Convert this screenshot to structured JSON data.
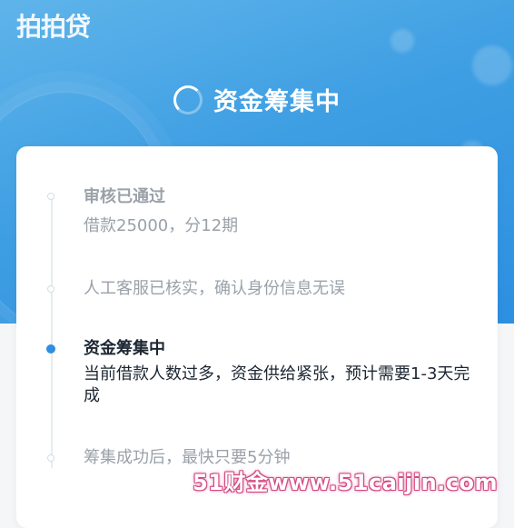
{
  "app": {
    "logo_text": "拍拍贷"
  },
  "status": {
    "title": "资金筹集中"
  },
  "steps": [
    {
      "title": "审核已通过",
      "desc": "借款25000，分12期"
    },
    {
      "title": "人工客服已核实，确认身份信息无误"
    },
    {
      "title": "资金筹集中",
      "desc": "当前借款人数过多，资金供给紧张，预计需要1-3天完成"
    },
    {
      "title": "筹集成功后，最快只要5分钟"
    }
  ],
  "watermark": {
    "text": "51财金www.51caijin.com"
  },
  "colors": {
    "header_gradient_start": "#5fb4ea",
    "header_gradient_end": "#2d8fe0",
    "active_dot": "#2f8ee0",
    "inactive_text": "#9aa1a9",
    "active_text": "#1c2733"
  }
}
